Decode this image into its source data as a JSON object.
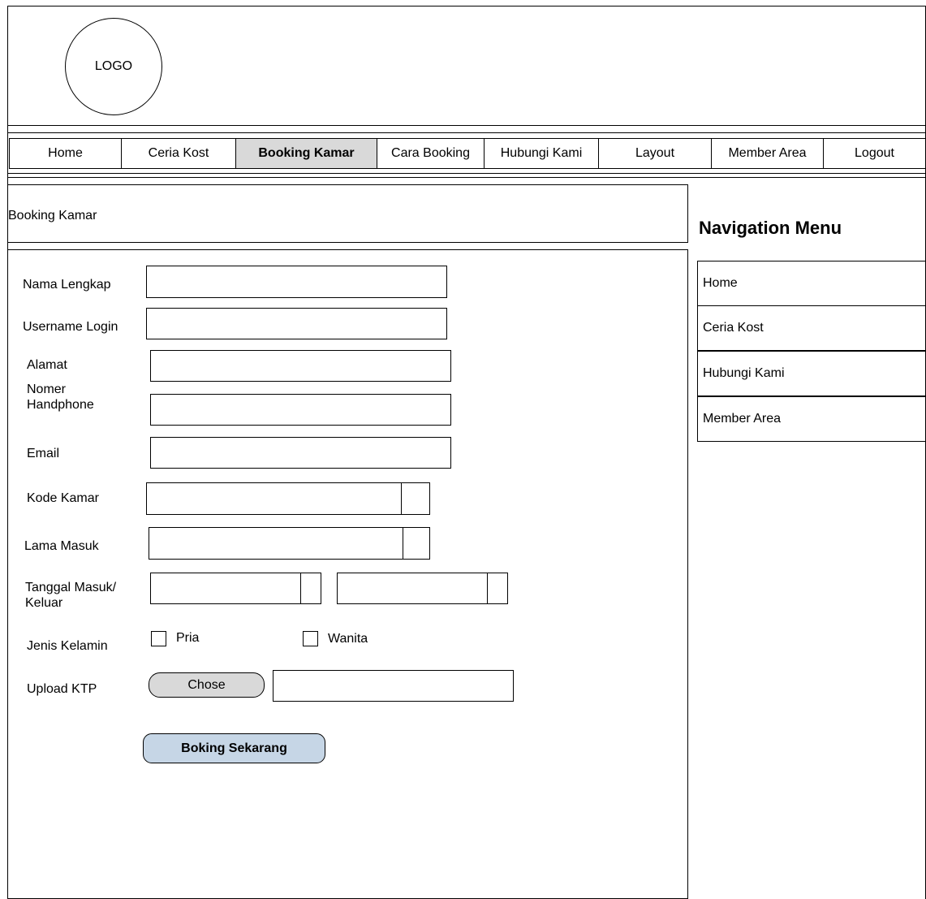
{
  "header": {
    "logo_label": "LOGO"
  },
  "nav": {
    "items": [
      {
        "label": "Home"
      },
      {
        "label": "Ceria Kost"
      },
      {
        "label": "Booking Kamar"
      },
      {
        "label": "Cara Booking"
      },
      {
        "label": "Hubungi Kami"
      },
      {
        "label": "Layout"
      },
      {
        "label": "Member Area"
      },
      {
        "label": "Logout"
      }
    ],
    "active": "Booking Kamar"
  },
  "main": {
    "title": "Booking Kamar",
    "form": {
      "nama_lengkap": "Nama Lengkap",
      "username_login": "Username Login",
      "alamat": "Alamat",
      "nomer_handphone_1": "Nomer",
      "nomer_handphone_2": "Handphone",
      "email": "Email",
      "kode_kamar": "Kode Kamar",
      "lama_masuk": "Lama Masuk",
      "tanggal_1": "Tanggal Masuk/",
      "tanggal_2": "Keluar",
      "jenis_kelamin": "Jenis Kelamin",
      "pria": "Pria",
      "wanita": "Wanita",
      "upload_ktp": "Upload KTP",
      "chose_label": "Chose",
      "submit_label": "Boking Sekarang"
    }
  },
  "sidebar": {
    "title": "Navigation Menu",
    "items": [
      {
        "label": "Home"
      },
      {
        "label": "Ceria Kost"
      },
      {
        "label": "Hubungi Kami"
      },
      {
        "label": "Member Area"
      }
    ]
  },
  "colors": {
    "active_tab": "#d9d9d9",
    "chose_button": "#d9d9d9",
    "submit_button": "#c6d6e6"
  }
}
